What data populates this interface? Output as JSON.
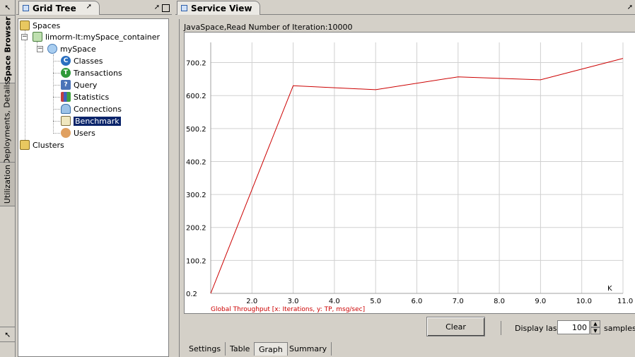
{
  "vertical_tabs": {
    "space_browser": "Space Browser",
    "deployments": "Deployments, Details",
    "utilization": "Utilization"
  },
  "grid_tree": {
    "title": "Grid Tree",
    "nodes": {
      "spaces": "Spaces",
      "container": "limorm-lt:mySpace_container",
      "myspace": "mySpace",
      "classes": "Classes",
      "transactions": "Transactions",
      "query": "Query",
      "statistics": "Statistics",
      "connections": "Connections",
      "benchmark": "Benchmark",
      "users": "Users",
      "clusters": "Clusters"
    },
    "icons": {
      "classes": "C",
      "transactions": "T",
      "query": "?"
    }
  },
  "service_view": {
    "title": "Service View",
    "chart_heading": "JavaSpace,Read Number of Iteration:10000",
    "clear_label": "Clear",
    "display_last_label": "Display last",
    "samples_value": "100",
    "samples_label": "samples",
    "bottom_tabs": [
      "Settings",
      "Table",
      "Graph",
      "Summary"
    ]
  },
  "chart_data": {
    "type": "line",
    "title": "JavaSpace,Read Number of Iteration:10000",
    "xlabel": "Global Throughput [x: Iterations, y: TP, msg/sec]",
    "x_unit_label": "K",
    "x": [
      1.0,
      3.0,
      5.0,
      7.0,
      9.0,
      11.0
    ],
    "y": [
      0.2,
      630,
      618,
      657,
      648,
      713
    ],
    "xlim": [
      1.0,
      11.0
    ],
    "ylim": [
      0.2,
      740
    ],
    "xticks": [
      "2.0",
      "3.0",
      "4.0",
      "5.0",
      "6.0",
      "7.0",
      "8.0",
      "9.0",
      "10.0",
      "11.0"
    ],
    "xtick_values": [
      2,
      3,
      4,
      5,
      6,
      7,
      8,
      9,
      10,
      11
    ],
    "yticks": [
      "0.2",
      "100.2",
      "200.2",
      "300.2",
      "400.2",
      "500.2",
      "600.2",
      "700.2"
    ],
    "ytick_values": [
      0.2,
      100.2,
      200.2,
      300.2,
      400.2,
      500.2,
      600.2,
      700.2
    ],
    "grid": true,
    "line_color": "#cc0000",
    "label_color": "#cc0000"
  }
}
